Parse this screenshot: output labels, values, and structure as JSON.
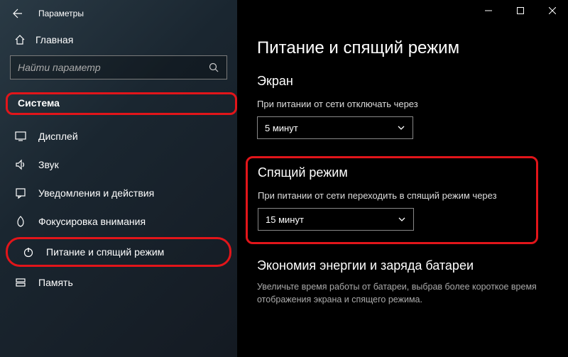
{
  "titlebar": {
    "label": "Параметры"
  },
  "sidebar": {
    "home_label": "Главная",
    "search_placeholder": "Найти параметр",
    "category_label": "Система",
    "items": [
      {
        "label": "Дисплей"
      },
      {
        "label": "Звук"
      },
      {
        "label": "Уведомления и действия"
      },
      {
        "label": "Фокусировка внимания"
      },
      {
        "label": "Питание и спящий режим"
      },
      {
        "label": "Память"
      }
    ]
  },
  "main": {
    "title": "Питание и спящий режим",
    "screen": {
      "heading": "Экран",
      "label": "При питании от сети отключать через",
      "value": "5 минут"
    },
    "sleep": {
      "heading": "Спящий режим",
      "label": "При питании от сети переходить в спящий режим через",
      "value": "15 минут"
    },
    "battery": {
      "heading": "Экономия энергии и заряда батареи",
      "desc": "Увеличьте время работы от батареи, выбрав более короткое время отображения экрана и спящего режима."
    }
  }
}
